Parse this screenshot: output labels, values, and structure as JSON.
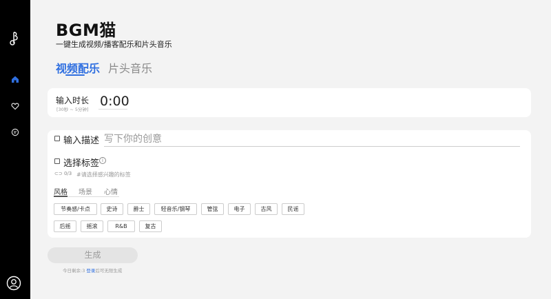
{
  "app": {
    "title": "BGM猫",
    "subtitle": "一键生成视频/播客配乐和片头音乐"
  },
  "sidebar": {
    "logo_icon": "music-note-logo",
    "items": [
      {
        "name": "home",
        "icon": "home-icon",
        "active": true
      },
      {
        "name": "favorites",
        "icon": "heart-icon",
        "active": false
      },
      {
        "name": "feedback",
        "icon": "chat-icon",
        "active": false
      }
    ],
    "avatar_icon": "user-avatar-icon"
  },
  "tabs": [
    {
      "label": "视频配乐",
      "active": true
    },
    {
      "label": "片头音乐",
      "active": false
    }
  ],
  "duration": {
    "label": "输入时长",
    "hint": "[30秒 ~ 5分钟]",
    "value": "0:00"
  },
  "description": {
    "label": "输入描述",
    "placeholder": "写下你的创意"
  },
  "tags": {
    "label": "选择标签",
    "count": "0/3",
    "hint": "#请选择感兴趣的标签",
    "categories": [
      {
        "label": "风格",
        "active": true
      },
      {
        "label": "场景",
        "active": false
      },
      {
        "label": "心情",
        "active": false
      }
    ],
    "row1": [
      "节奏感/卡点",
      "史诗",
      "爵士",
      "轻音乐/钢琴",
      "管弦",
      "电子",
      "古风",
      "民谣"
    ],
    "row2": [
      "后摇",
      "摇滚",
      "R&B",
      "复古"
    ]
  },
  "generate": {
    "label": "生成",
    "remain_prefix": "今日剩余:3",
    "login_link": "登录",
    "remain_suffix": "后可无限生成"
  },
  "colors": {
    "accent": "#2f6fe0",
    "sidebar_bg": "#000000",
    "page_bg": "#f3f3f3"
  }
}
